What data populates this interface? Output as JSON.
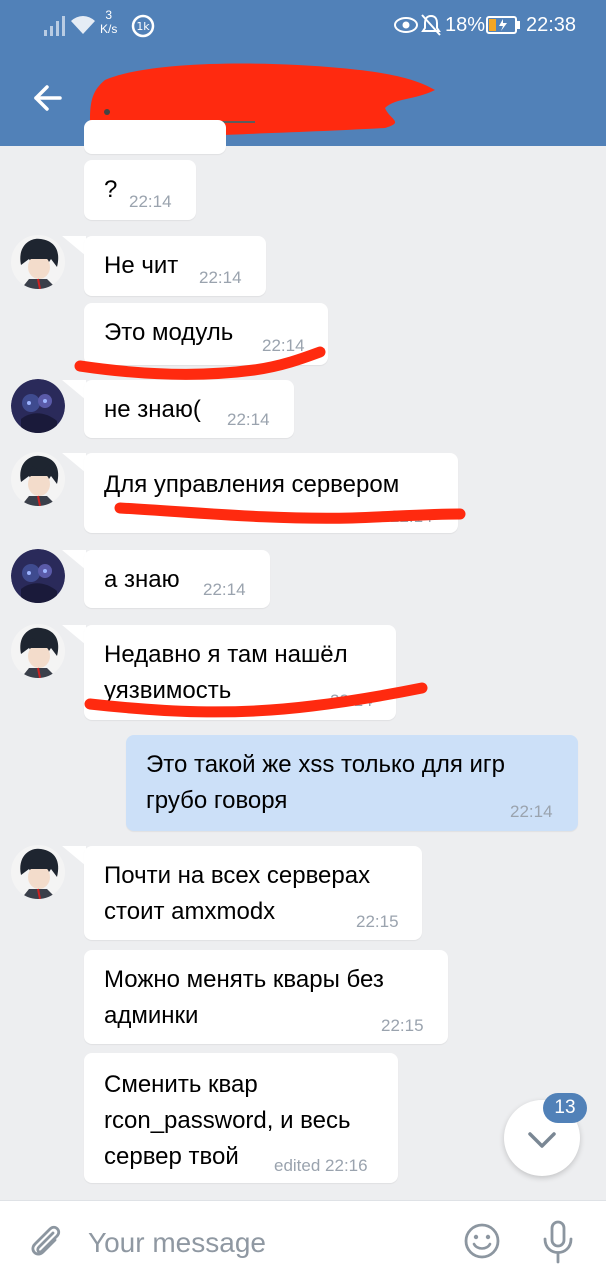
{
  "status_bar": {
    "speed_value": "3",
    "speed_unit": "K/s",
    "battery_percent": "18%",
    "time": "22:38"
  },
  "header": {
    "title": ""
  },
  "messages": [
    {
      "text": "?",
      "time": "22:14"
    },
    {
      "text": "Не чит",
      "time": "22:14"
    },
    {
      "text": "Это модуль",
      "time": "22:14"
    },
    {
      "text": "не знаю(",
      "time": "22:14"
    },
    {
      "text": "Для управления сервером",
      "time": "22:14"
    },
    {
      "text": "а знаю",
      "time": "22:14"
    },
    {
      "text": "Недавно я там нашёл\nуязвимость",
      "time": "22:14"
    },
    {
      "text": "Это такой же xss только для игр\nгрубо говоря",
      "time": "22:14"
    },
    {
      "text": "Почти на всех серверах\nстоит amxmodx",
      "time": "22:15"
    },
    {
      "text": "Можно менять квары без\nадминки",
      "time": "22:15"
    },
    {
      "text": "Сменить квар\nrcon_password, и весь\nсервер твой",
      "time": "edited 22:16"
    }
  ],
  "scroll_fab": {
    "unread_count": "13"
  },
  "composer": {
    "placeholder": "Your message"
  },
  "colors": {
    "accent": "#5181b8",
    "background": "#edeef0",
    "outgoing_bubble": "#cce0f8",
    "scribble": "#ff2a0f"
  },
  "icons": [
    "signal-icon",
    "wifi-icon",
    "data-saver-icon",
    "eye-icon",
    "mute-bell-icon",
    "battery-icon",
    "back-arrow-icon",
    "attach-icon",
    "emoji-icon",
    "mic-icon",
    "chevron-down-icon"
  ]
}
